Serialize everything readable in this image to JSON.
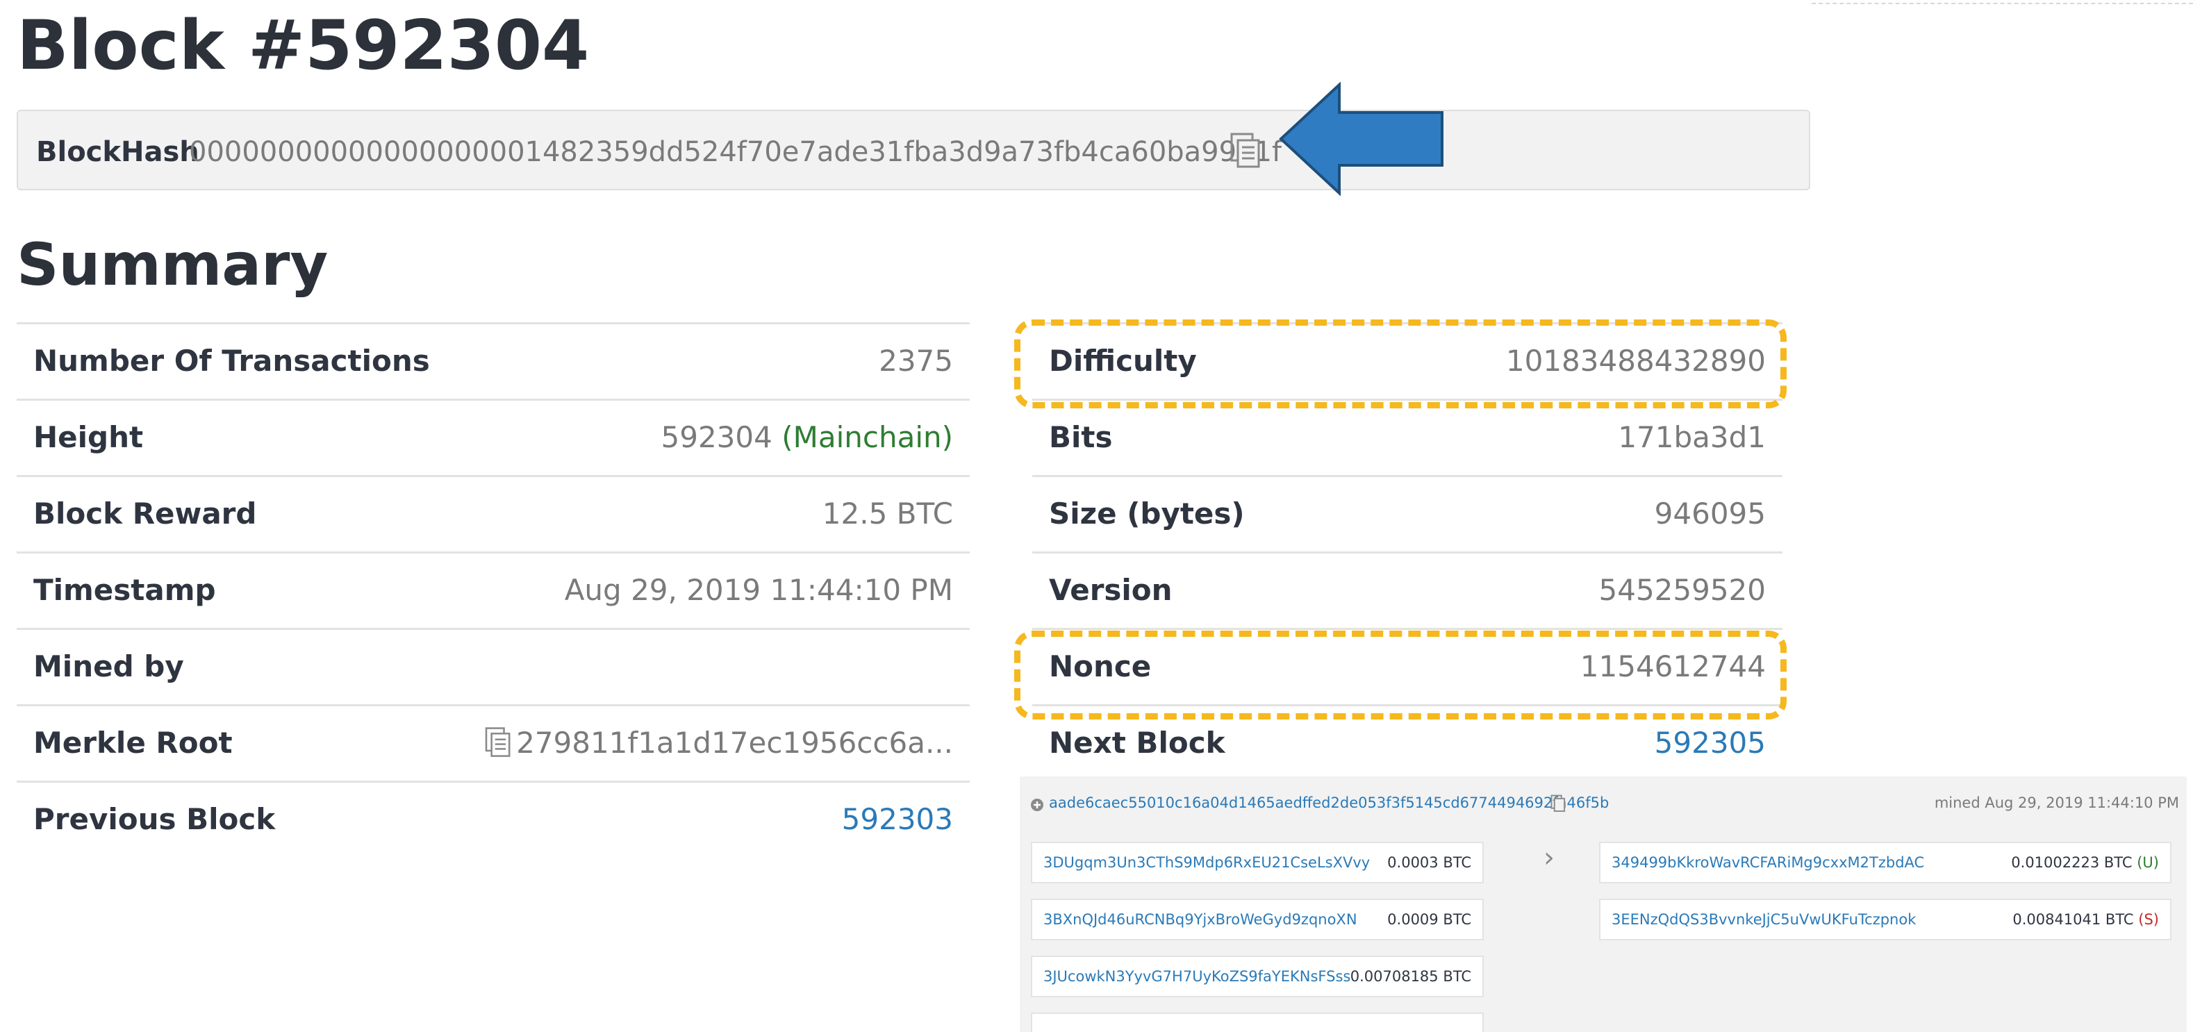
{
  "block": {
    "title": "Block #592304",
    "hash_label": "BlockHash",
    "hash_value": "00000000000000000001482359dd524f70e7ade31fba3d9a73fb4ca60ba9921f"
  },
  "summary": {
    "title": "Summary",
    "left_rows": [
      {
        "label": "Number Of Transactions",
        "value": "2375"
      },
      {
        "label": "Height",
        "value": "592304",
        "extra": "(Mainchain)"
      },
      {
        "label": "Block Reward",
        "value": "12.5 BTC"
      },
      {
        "label": "Timestamp",
        "value": "Aug 29, 2019 11:44:10 PM"
      },
      {
        "label": "Mined by",
        "value": ""
      },
      {
        "label": "Merkle Root",
        "value": "279811f1a1d17ec1956cc6a..."
      },
      {
        "label": "Previous Block",
        "value": "592303"
      }
    ],
    "right_rows": [
      {
        "label": "Difficulty",
        "value": "10183488432890"
      },
      {
        "label": "Bits",
        "value": "171ba3d1"
      },
      {
        "label": "Size (bytes)",
        "value": "946095"
      },
      {
        "label": "Version",
        "value": "545259520"
      },
      {
        "label": "Nonce",
        "value": "1154612744"
      },
      {
        "label": "Next Block",
        "value": "592305"
      }
    ]
  },
  "transaction": {
    "hash": "aade6caec55010c16a04d1465aedffed2de053f3f5145cd6774494692fa46f5b",
    "mined": "mined Aug 29, 2019 11:44:10 PM",
    "inputs": [
      {
        "address": "3DUgqm3Un3CThS9Mdp6RxEU21CseLsXVvy",
        "amount": "0.0003 BTC"
      },
      {
        "address": "3BXnQJd46uRCNBq9YjxBroWeGyd9zqnoXN",
        "amount": "0.0009 BTC"
      },
      {
        "address": "3JUcowkN3YyvG7H7UyKoZS9faYEKNsFSss",
        "amount": "0.00708185 BTC"
      },
      {
        "address": "",
        "amount": ""
      }
    ],
    "outputs": [
      {
        "address": "349499bKkroWavRCFARiMg9cxxM2TzbdAC",
        "amount": "0.01002223 BTC",
        "flag": "(U)"
      },
      {
        "address": "3EENzQdQS3BvvnkeJjC5uVwUKFuTczpnok",
        "amount": "0.00841041 BTC",
        "flag": "(S)"
      }
    ]
  },
  "colors": {
    "link": "#2a7ab8",
    "mainchain": "#2e7d32",
    "highlight": "#f5b81e",
    "arrow": "#2f7cc2"
  },
  "icons": [
    "copy-icon",
    "arrow-left-icon",
    "circle-plus-icon",
    "chevron-right-icon"
  ]
}
